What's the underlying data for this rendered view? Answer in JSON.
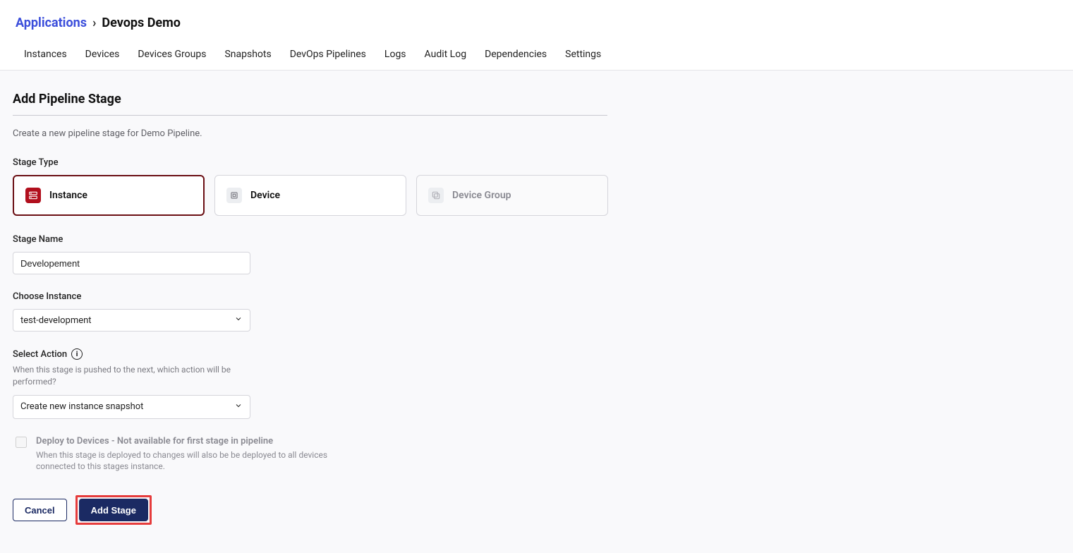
{
  "breadcrumb": {
    "root": "Applications",
    "separator": "›",
    "current": "Devops Demo"
  },
  "tabs": [
    "Instances",
    "Devices",
    "Devices Groups",
    "Snapshots",
    "DevOps Pipelines",
    "Logs",
    "Audit Log",
    "Dependencies",
    "Settings"
  ],
  "page": {
    "title": "Add Pipeline Stage",
    "description": "Create a new pipeline stage for Demo Pipeline."
  },
  "stage_type": {
    "label": "Stage Type",
    "options": {
      "instance": "Instance",
      "device": "Device",
      "device_group": "Device Group"
    }
  },
  "stage_name": {
    "label": "Stage Name",
    "value": "Developement"
  },
  "choose_instance": {
    "label": "Choose Instance",
    "selected": "test-development"
  },
  "select_action": {
    "label": "Select Action",
    "info_glyph": "i",
    "helper": "When this stage is pushed to the next, which action will be performed?",
    "selected": "Create new instance snapshot"
  },
  "deploy_checkbox": {
    "label": "Deploy to Devices - Not available for first stage in pipeline",
    "description": "When this stage is deployed to changes will also be be deployed to all devices connected to this stages instance."
  },
  "buttons": {
    "cancel": "Cancel",
    "add_stage": "Add Stage"
  }
}
